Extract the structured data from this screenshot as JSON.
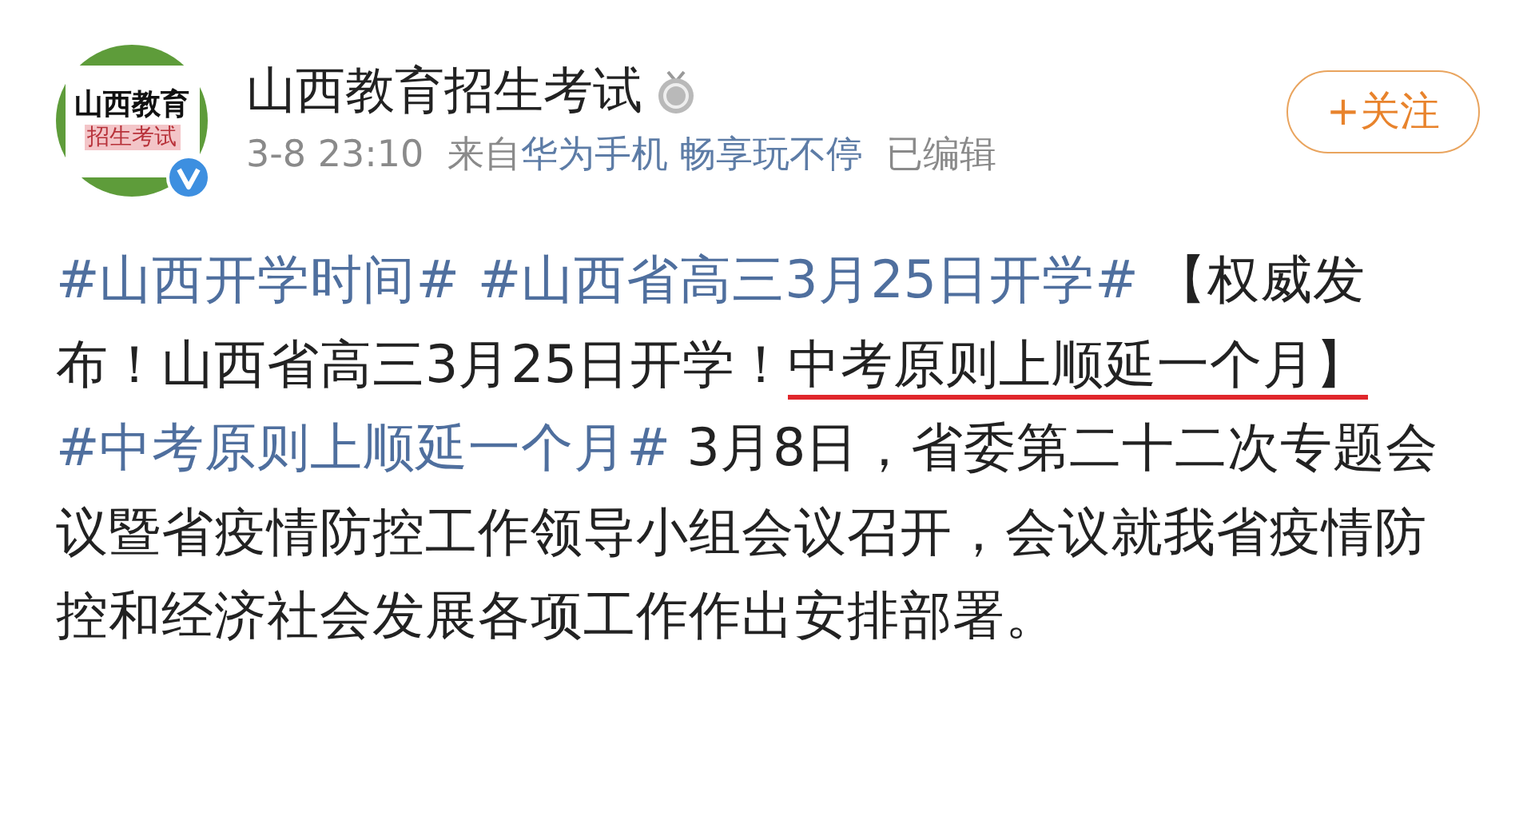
{
  "post": {
    "avatar": {
      "lines": [
        "山西教育",
        "招生考试"
      ],
      "verified": true
    },
    "author": "山西教育招生考试",
    "time": "3-8 23:10",
    "source_prefix": "来自",
    "source": "华为手机 畅享玩不停",
    "edited": "已编辑",
    "follow_button": "+关注",
    "body": [
      {
        "kind": "topic",
        "text": "#山西开学时间#"
      },
      {
        "kind": "topic",
        "text": "#山西省高三3月25日开学#"
      },
      {
        "kind": "text",
        "text": " 【权威发布！山西省高三3月25日开学！"
      },
      {
        "kind": "marked",
        "text": "中考原则上顺延一个月】"
      },
      {
        "kind": "topic",
        "text": "#中考原则上顺延一个月#"
      },
      {
        "kind": "text",
        "text": " 3月8日，省委第二十二次专题会议暨省疫情防控工作领导小组会议召开，会议就我省疫情防控和经济社会发展各项工作作出安排部署。"
      }
    ]
  }
}
